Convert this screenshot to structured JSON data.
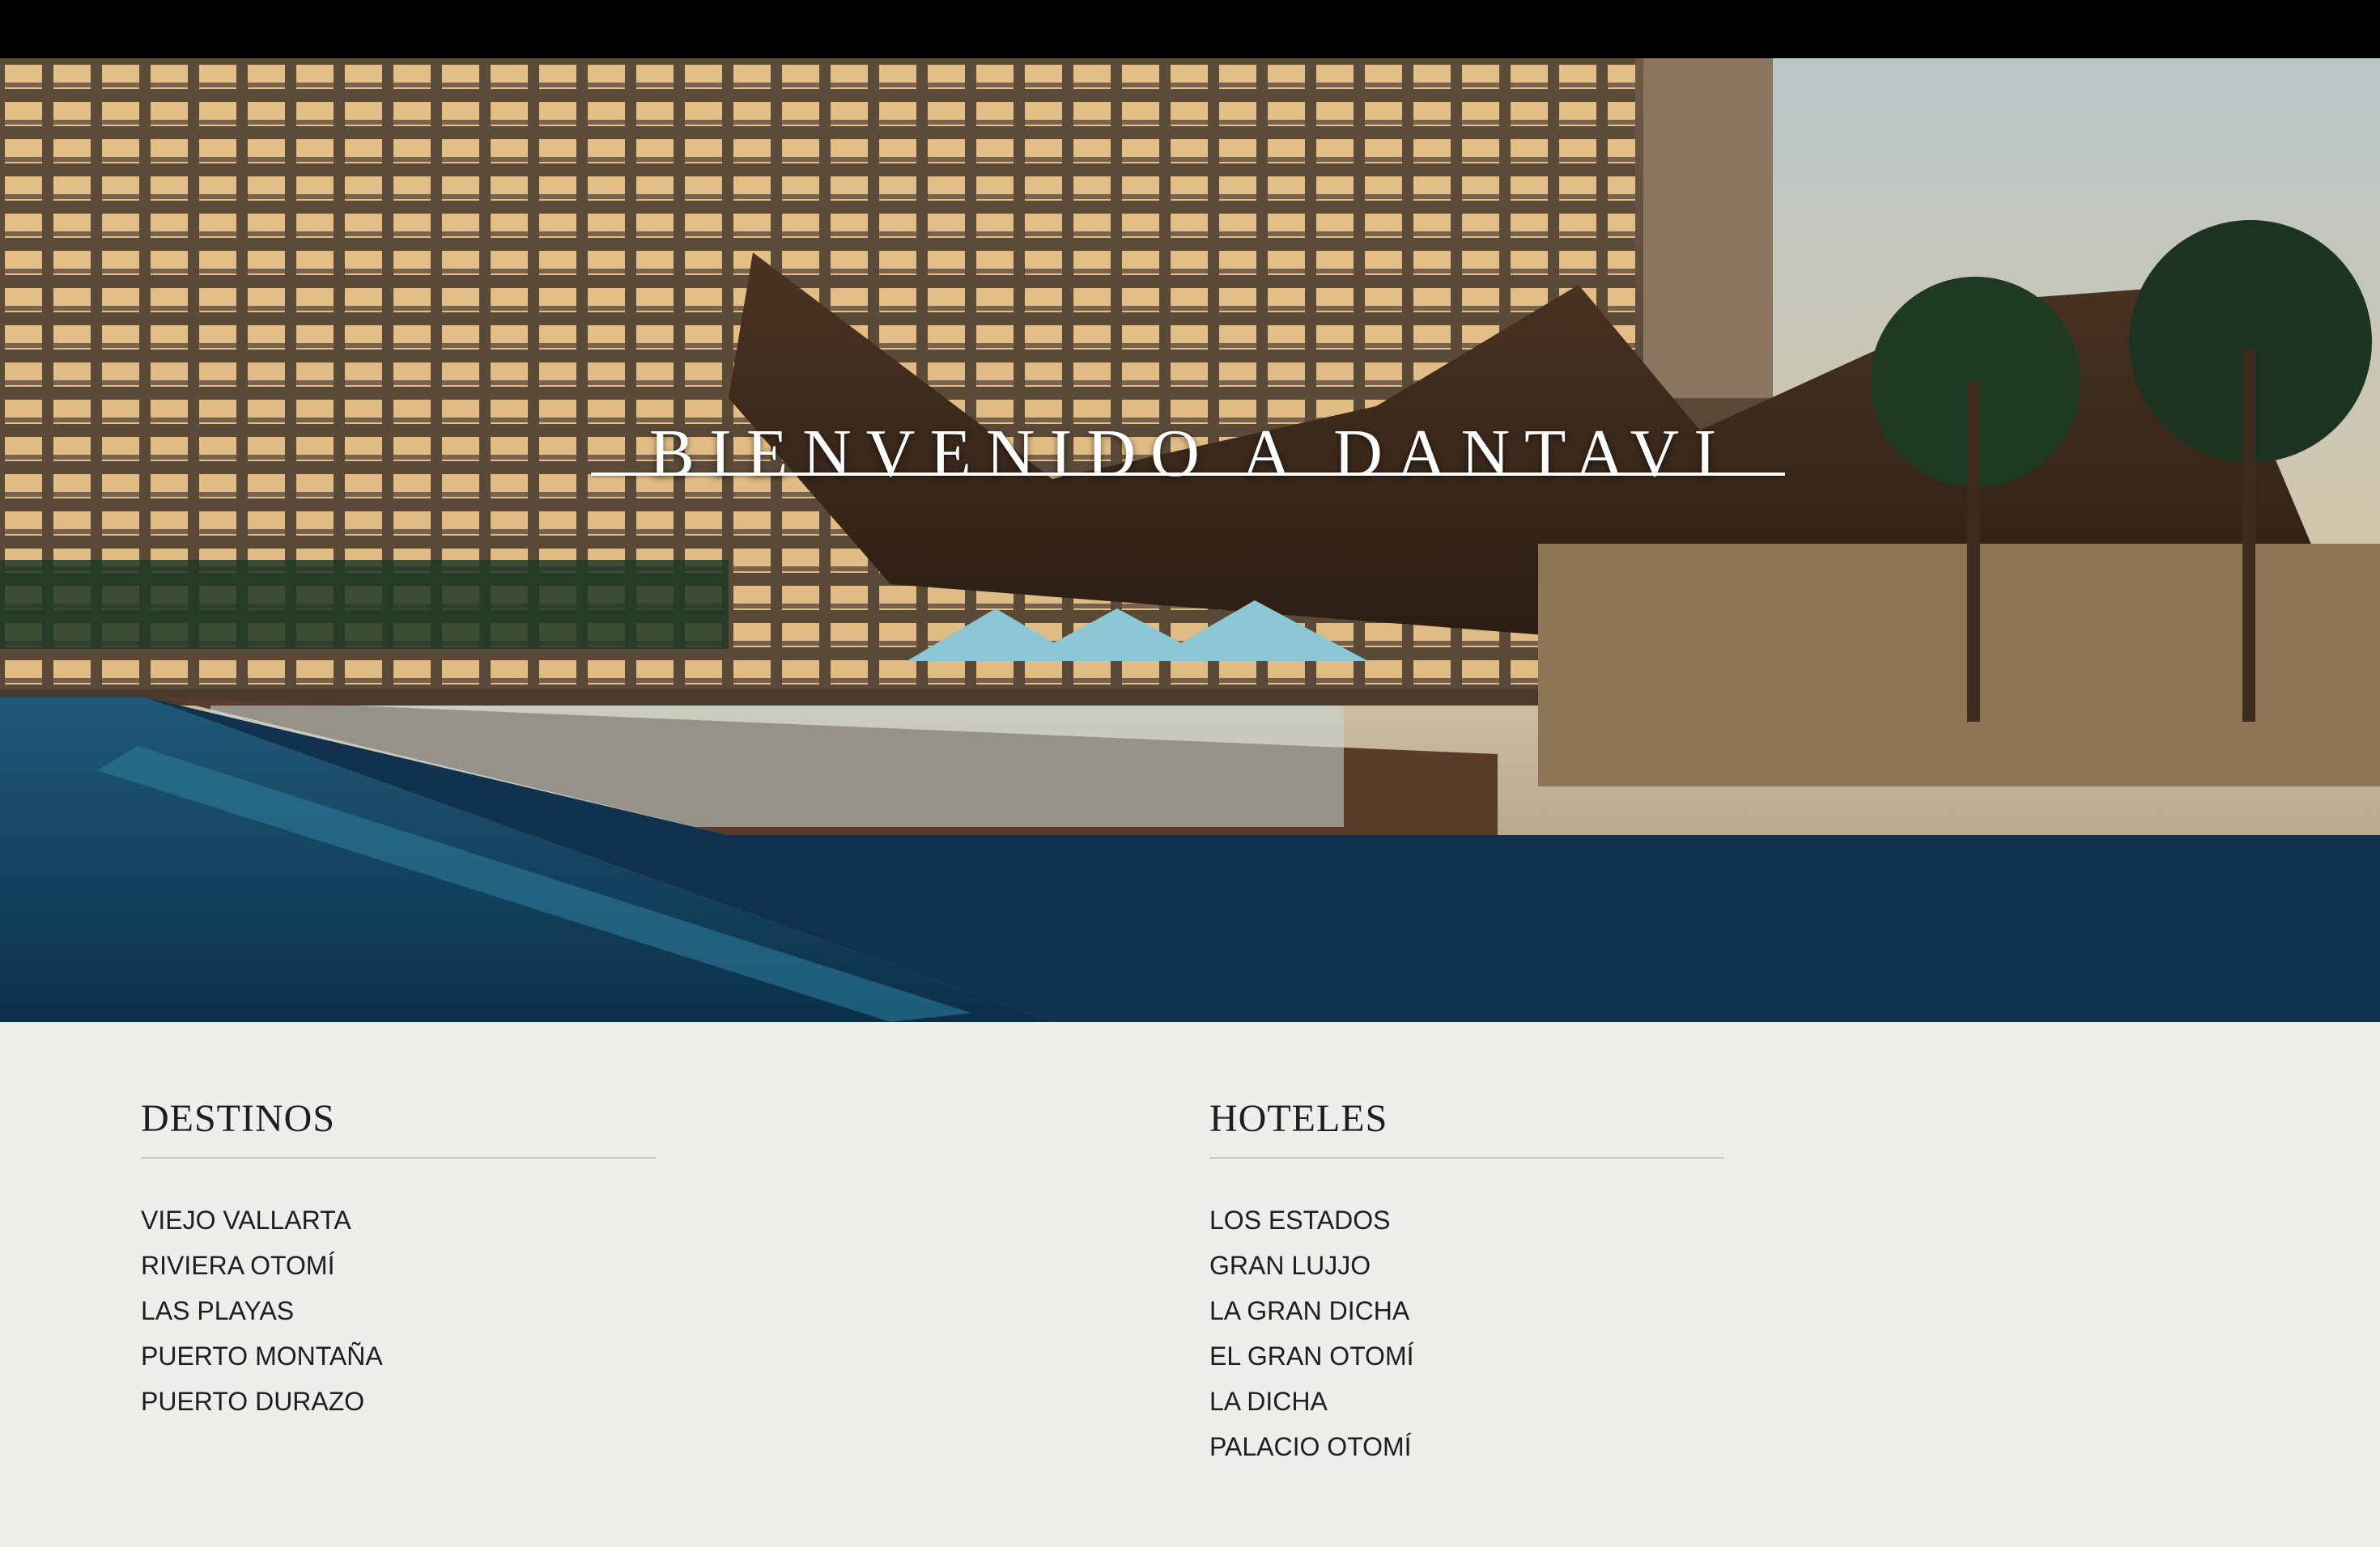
{
  "hero": {
    "title": "BIENVENIDO A DANTAVI"
  },
  "destinos": {
    "heading": "DESTINOS",
    "items": [
      "VIEJO VALLARTA",
      "RIVIERA OTOMÍ",
      "LAS PLAYAS",
      "PUERTO MONTAÑA",
      "PUERTO DURAZO"
    ]
  },
  "hoteles": {
    "heading": "HOTELES",
    "items": [
      "LOS ESTADOS",
      "GRAN LUJJO",
      "LA GRAN DICHA",
      "EL GRAN OTOMÍ",
      "LA DICHA",
      "PALACIO OTOMÍ"
    ]
  },
  "colors": {
    "topbar": "#000000",
    "background": "#efeeea",
    "text": "#1e1e1e"
  }
}
